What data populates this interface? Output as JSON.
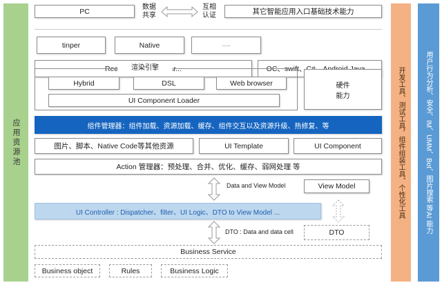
{
  "side": {
    "left": "应用资源池",
    "orange": "开发工具、测试工具，组件组装工具、个性化工具",
    "blue": "用户行为分析、安全、IM、UMM、Bot、图片搜索 等AI 能力"
  },
  "top": {
    "pc": "PC",
    "share": "数据共享",
    "auth": "互相认证",
    "other": "其它智能应用入口基础技术能力"
  },
  "frameworks": {
    "tinper": "tinper",
    "native": "Native",
    "more": "......",
    "react": "React、Vue、Angular...",
    "oc": "OC、swift、C#、Android Java ..."
  },
  "render": {
    "title": "渲染引擎",
    "hybrid": "Hybrid",
    "dsl": "DSL",
    "web": "Web browser",
    "loader": "UI Component Loader",
    "hardware": "硬件能力"
  },
  "manager": "组件管理器：组件加载、资源加载、缓存、组件交互以及资源升级、热修复、等",
  "resources": {
    "images": "图片、脚本、Native Code等其他资源",
    "template": "UI Template",
    "component": "UI Component"
  },
  "action": "Action 管理器：预处理、合并、优化、缓存、弱网处理 等",
  "mvm": {
    "label": "Data and View Model",
    "viewmodel": "View Model"
  },
  "controller": "UI Controller : Dispatcher、filter、UI Logic、DTO to View Model ...",
  "dto": {
    "label": "DTO : Data and  data cell",
    "box": "DTO"
  },
  "business": {
    "service": "Business Service",
    "object": "Business object",
    "rules": "Rules",
    "logic": "Business Logic"
  }
}
